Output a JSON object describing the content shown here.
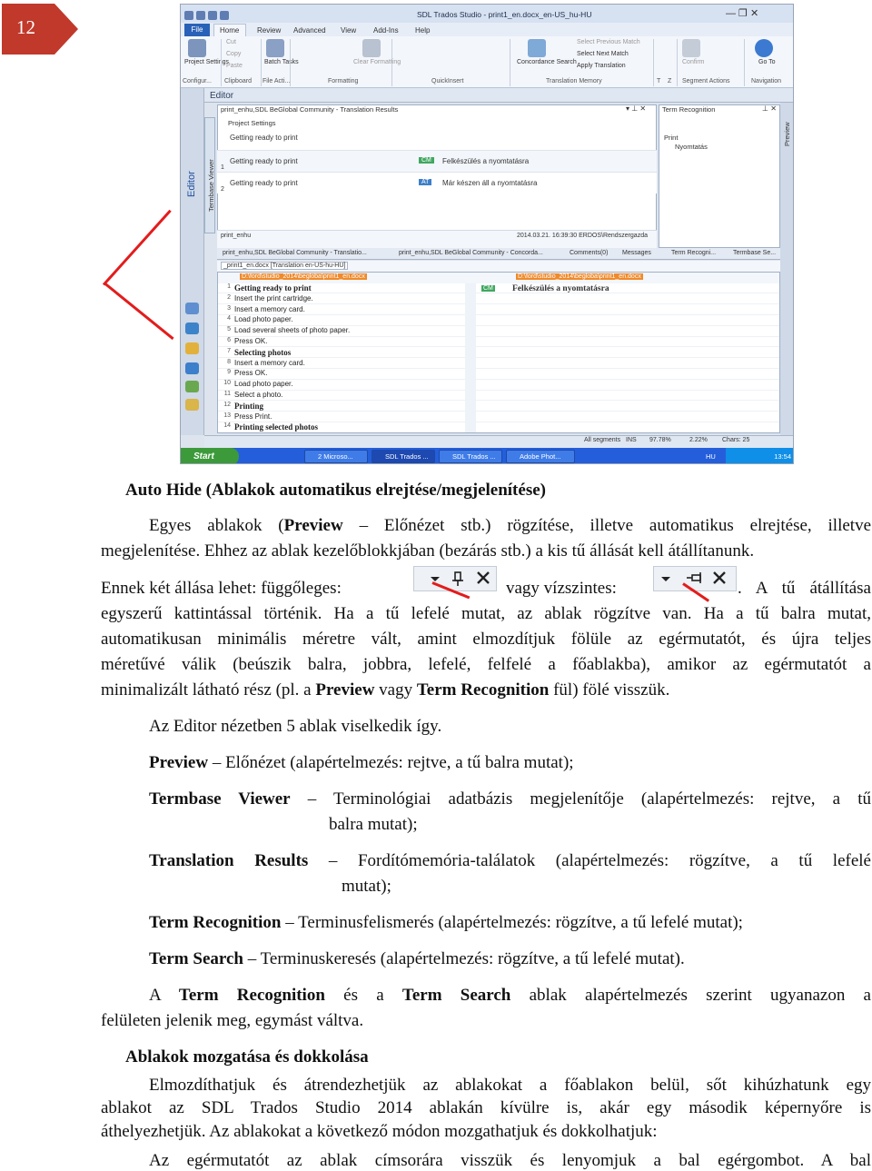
{
  "page_number": "12",
  "screenshot": {
    "title": "SDL Trados Studio - print1_en.docx_en-US_hu-HU",
    "ribbon_tabs": [
      "File",
      "Home",
      "Review",
      "Advanced",
      "View",
      "Add-Ins",
      "Help"
    ],
    "ribbon_items": {
      "project_settings": "Project Settings",
      "batch_tasks": "Batch Tasks",
      "cut": "Cut",
      "copy": "Copy",
      "paste": "Paste",
      "clear_formatting": "Clear Formatting",
      "concordance_search": "Concordance Search",
      "select_previous_match": "Select Previous Match",
      "select_next_match": "Select Next Match",
      "apply_translation": "Apply Translation",
      "confirm": "Confirm",
      "go_to": "Go To"
    },
    "ribbon_groups": [
      "Configur...",
      "Clipboard",
      "File Acti...",
      "Formatting",
      "QuickInsert",
      "Translation Memory",
      "T",
      "Z",
      "Segment Actions",
      "Navigation"
    ],
    "editor_label": "Editor",
    "side_labels": {
      "editor": "Editor",
      "termbase_viewer": "Termbase Viewer",
      "preview": "Preview"
    },
    "translation_results": {
      "header": "print_enhu,SDL BeGlobal Community - Translation Results",
      "project_settings": "Project Settings",
      "source_line": "Getting ready to print",
      "rows": [
        {
          "n": "1",
          "src": "Getting ready to print",
          "tag": "CM",
          "tgt": "Felkészülés a nyomtatásra"
        },
        {
          "n": "2",
          "src": "Getting ready to print",
          "tag": "AT",
          "tgt": "Már készen áll a nyomtatásra"
        }
      ],
      "footer_name": "print_enhu",
      "footer_meta": "2014.03.21. 16:39:30  ERDOS\\Rendszergazda",
      "tabs": [
        "print_enhu,SDL BeGlobal Community - Translatio...",
        "print_enhu,SDL BeGlobal Community - Concorda...",
        "Comments(0)",
        "Messages",
        "Term Recogni...",
        "Termbase Se..."
      ]
    },
    "term_recognition": {
      "header": "Term Recognition",
      "term": "Print",
      "translation": "Nyomtatás"
    },
    "grid": {
      "file_tab": "_print1_en.docx [Translation en-US-hu-HU]",
      "path_left": "D:\\ford\\studio_2014\\begloba\\print1_en.docx",
      "path_right": "D:\\ford\\studio_2014\\begloba\\print1_en.docx",
      "row1_tag": "CM",
      "row1_target": "Felkészülés a nyomtatásra",
      "rows": [
        {
          "n": "1",
          "src": "Getting ready to print",
          "st": "H"
        },
        {
          "n": "2",
          "src": "Insert the print cartridge.",
          "st": "P"
        },
        {
          "n": "3",
          "src": "Insert a memory card.",
          "st": "P"
        },
        {
          "n": "4",
          "src": "Load photo paper.",
          "st": "P"
        },
        {
          "n": "5",
          "src": "Load several sheets of photo paper.",
          "st": "P"
        },
        {
          "n": "6",
          "src": "Press OK.",
          "st": "P"
        },
        {
          "n": "7",
          "src": "Selecting photos",
          "st": "H"
        },
        {
          "n": "8",
          "src": "Insert a memory card.",
          "st": "P"
        },
        {
          "n": "9",
          "src": "Press OK.",
          "st": "P"
        },
        {
          "n": "10",
          "src": "Load photo paper.",
          "st": "P"
        },
        {
          "n": "11",
          "src": "Select a photo.",
          "st": "P"
        },
        {
          "n": "12",
          "src": "Printing",
          "st": "H"
        },
        {
          "n": "13",
          "src": "Press Print.",
          "st": "P"
        },
        {
          "n": "14",
          "src": "Printing selected photos",
          "st": "H"
        }
      ]
    },
    "statusbar": {
      "segments": "All segments",
      "ins": "INS",
      "pct1": "97.78%",
      "pct2": "2.22%",
      "chars": "Chars: 25"
    },
    "taskbar": {
      "start": "Start",
      "buttons": [
        "2 Microso...",
        "SDL Trados ...",
        "SDL Trados ...",
        "Adobe Phot..."
      ],
      "lang": "HU",
      "time": "13:54"
    }
  },
  "text": {
    "heading1": "Auto Hide (Ablakok automatikus elrejtése/megjelenítése)",
    "p1_l1_a": "Egyes ablakok (",
    "p1_l1_b": "Preview",
    "p1_l1_c": " – Előnézet stb.) rögzítése, illetve automatikus elrejtése, illetve",
    "p1_l2": "megjelenítése. Ehhez az ablak kezelőblokkjában (bezárás stb.) a kis tű állását kell átállítanunk.",
    "p2_l1_a": "Ennek két állása lehet: függőleges:",
    "p2_l1_b": "vagy vízszintes:",
    "p2_l1_c": ". A tű átállítása",
    "p2_l2_a": "egyszerű kattintással történik. Ha a tű lefelé mutat, az ablak rögzítve van.",
    "p2_l2_b": " Ha a tű balra mutat,",
    "p2_l3": "automatikusan minimális méretre vált, amint elmozdítjuk fölüle az egérmutatót, és újra teljes",
    "p2_l4": "méretűvé válik (beúszik balra, jobbra, lefelé, felfelé a főablakba), amikor az egérmutatót a",
    "p2_l5_a": "minimalizált látható rész (pl. a ",
    "p2_l5_b": "Preview",
    "p2_l5_c": " vagy ",
    "p2_l5_d": "Term Recognition",
    "p2_l5_e": " fül) fölé visszük.",
    "p3": "Az Editor nézetben 5 ablak viselkedik így.",
    "li1_b": "Preview",
    "li1_t": " – Előnézet (alapértelmezés: rejtve, a tű balra mutat);",
    "li2_b": "Termbase Viewer",
    "li2_t": " – Terminológiai adatbázis megjelenítője (alapértelmezés: rejtve, a tű",
    "li2_t2": "balra mutat);",
    "li3_b": "Translation Results",
    "li3_t": " – Fordítómemória-találatok (alapértelmezés: rögzítve, a tű lefelé",
    "li3_t2": "mutat);",
    "li4_b": "Term Recognition",
    "li4_t": " – Terminusfelismerés (alapértelmezés: rögzítve, a tű lefelé mutat);",
    "li5_b": "Term Search",
    "li5_t": " – Terminuskeresés (alapértelmezés: rögzítve, a tű lefelé mutat).",
    "p4_l1_a": "A ",
    "p4_l1_b": "Term Recognition",
    "p4_l1_c": " és a ",
    "p4_l1_d": "Term Search",
    "p4_l1_e": " ablak alapértelmezés szerint ugyanazon a",
    "p4_l2": "felületen jelenik meg, egymást váltva.",
    "heading2": "Ablakok mozgatása és dokkolása",
    "p5_l1": "Elmozdíthatjuk és átrendezhetjük az ablakokat a főablakon belül, sőt kihúzhatunk egy",
    "p5_l2": "ablakot az SDL Trados Studio 2014 ablakán kívülre is, akár egy második képernyőre is",
    "p5_l3": "áthelyezhetjük. Az ablakokat a következő módon mozgathatjuk és dokkolhatjuk:",
    "p6_l1": "Az egérmutatót az ablak címsorára visszük és lenyomjuk a bal egérgombot. A bal"
  }
}
